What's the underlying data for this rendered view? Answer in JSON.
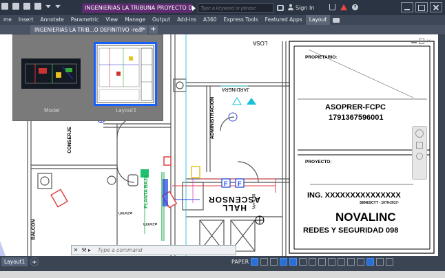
{
  "titlebar": {
    "doc_title": "INGENIERIAS LA TRIBUNA PROYECTO DEFIN...",
    "search_placeholder": "Type a keyword or phrase",
    "signin_label": "Sign In"
  },
  "ribbon_tabs": [
    {
      "label": "me",
      "active": false
    },
    {
      "label": "Insert",
      "active": false
    },
    {
      "label": "Annotate",
      "active": false
    },
    {
      "label": "Parametric",
      "active": false
    },
    {
      "label": "View",
      "active": false
    },
    {
      "label": "Manage",
      "active": false
    },
    {
      "label": "Output",
      "active": false
    },
    {
      "label": "Add-ins",
      "active": false
    },
    {
      "label": "A360",
      "active": false
    },
    {
      "label": "Express Tools",
      "active": false
    },
    {
      "label": "Featured Apps",
      "active": false
    },
    {
      "label": "Layout",
      "active": true
    }
  ],
  "doc_tab": {
    "label": "INGENIERIAS LA TRIB...O DEFINITIVO -real*",
    "close": "×",
    "add": "+"
  },
  "preview": {
    "model_label": "Model",
    "layout_label": "Layout1"
  },
  "title_block": {
    "owner_heading": "PROPIETARIO:",
    "owner_name": "ASOPRER-FCPC",
    "owner_id": "1791367596001",
    "project_heading": "PROYECTO:",
    "engineer": "ING.  XXXXXXXXXXXXXXX",
    "senescyt": "SENESCYT - 1079-2017-",
    "company": "NOVALINC",
    "company_sub": "REDES Y SEGURIDAD 098"
  },
  "plan_labels": {
    "losa": "LOSA",
    "jardinera": "JARDINERA",
    "administracion": "ADMINISTRACION",
    "conserje": "CONSERJE",
    "balcon": "BALCON",
    "hall_ascensor": "HALL ASCENSOR",
    "vestibulo": "PLANTA BAJA",
    "pipe1": "⌀25mm",
    "pipe2": "⌀25mm",
    "nv": "Nv+4.68"
  },
  "command": {
    "placeholder": "Type a command"
  },
  "statusbar": {
    "layout_tab": "Layout1",
    "add": "+",
    "paper": "PAPER"
  },
  "colors": {
    "accent_blue": "#1560ff",
    "title_purple": "#5e2b6f",
    "bg_dark": "#3b4453"
  }
}
